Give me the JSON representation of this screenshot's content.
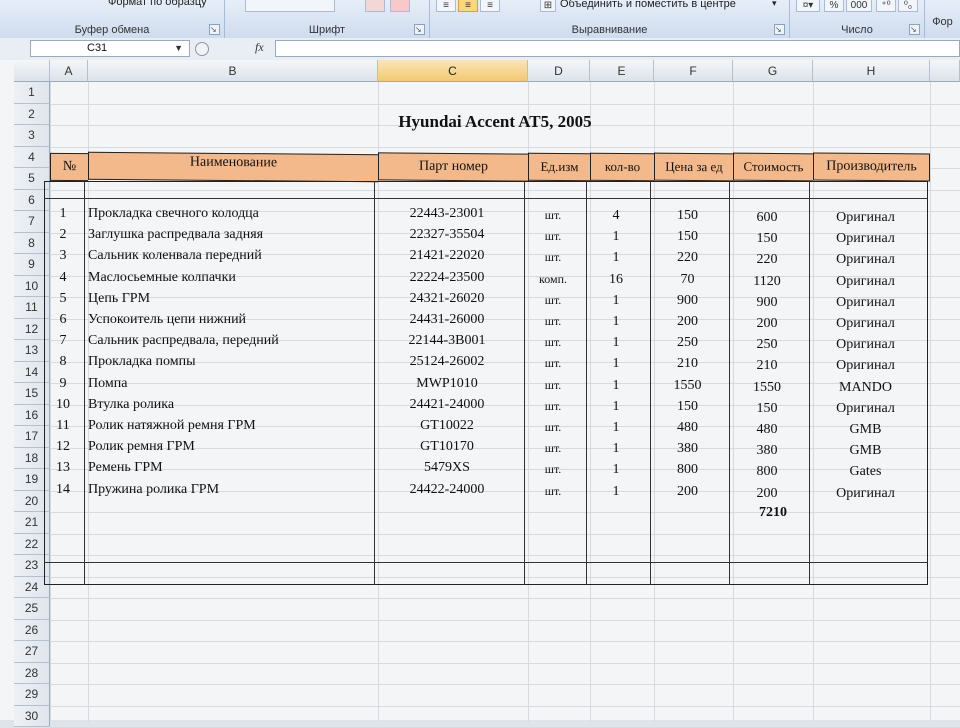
{
  "ribbon": {
    "clipboard_top": "Формат по образцу",
    "clipboard_label": "Буфер обмена",
    "font_label": "Шрифт",
    "merge_label": "Объединить и поместить в центре",
    "alignment_label": "Выравнивание",
    "number_label": "Число",
    "percent": "%",
    "thousands": "000",
    "styles_label": "Фор"
  },
  "formula_bar": {
    "name_box": "C31",
    "fx": "fx",
    "value": ""
  },
  "columns": [
    "A",
    "B",
    "C",
    "D",
    "E",
    "F",
    "G",
    "H"
  ],
  "selected_column": "C",
  "rows": [
    "1",
    "2",
    "3",
    "4",
    "5",
    "6",
    "7",
    "8",
    "9",
    "10",
    "11",
    "12",
    "13",
    "14",
    "15",
    "16",
    "17",
    "18",
    "19",
    "20",
    "21",
    "22",
    "23",
    "24",
    "25",
    "26",
    "27",
    "28",
    "29",
    "30"
  ],
  "sheet": {
    "title": "Hyundai Accent AT5, 2005",
    "headers": [
      "№",
      "Наименование",
      "Парт номер",
      "Ед.изм",
      "кол-во",
      "Цена за ед",
      "Стоимость",
      "Производитель"
    ],
    "items": [
      [
        "1",
        "Прокладка свечного колодца",
        "22443-23001",
        "шт.",
        "4",
        "150",
        "600",
        "Оригинал"
      ],
      [
        "2",
        "Заглушка распредвала задняя",
        "22327-35504",
        "шт.",
        "1",
        "150",
        "150",
        "Оригинал"
      ],
      [
        "3",
        "Сальник коленвала передний",
        "21421-22020",
        "шт.",
        "1",
        "220",
        "220",
        "Оригинал"
      ],
      [
        "4",
        "Маслосьемные колпачки",
        "22224-23500",
        "комп.",
        "16",
        "70",
        "1120",
        "Оригинал"
      ],
      [
        "5",
        "Цепь ГРМ",
        "24321-26020",
        "шт.",
        "1",
        "900",
        "900",
        "Оригинал"
      ],
      [
        "6",
        "Успокоитель цепи нижний",
        "24431-26000",
        "шт.",
        "1",
        "200",
        "200",
        "Оригинал"
      ],
      [
        "7",
        "Сальник распредвала, передний",
        "22144-3B001",
        "шт.",
        "1",
        "250",
        "250",
        "Оригинал"
      ],
      [
        "8",
        "Прокладка помпы",
        "25124-26002",
        "шт.",
        "1",
        "210",
        "210",
        "Оригинал"
      ],
      [
        "9",
        "Помпа",
        "MWP1010",
        "шт.",
        "1",
        "1550",
        "1550",
        "MANDO"
      ],
      [
        "10",
        "Втулка ролика",
        "24421-24000",
        "шт.",
        "1",
        "150",
        "150",
        "Оригинал"
      ],
      [
        "11",
        "Ролик натяжной ремня ГРМ",
        "GT10022",
        "шт.",
        "1",
        "480",
        "480",
        "GMB"
      ],
      [
        "12",
        "Ролик ремня ГРМ",
        "GT10170",
        "шт.",
        "1",
        "380",
        "380",
        "GMB"
      ],
      [
        "13",
        "Ремень ГРМ",
        "5479XS",
        "шт.",
        "1",
        "800",
        "800",
        "Gates"
      ],
      [
        "14",
        "Пружина ролика ГРМ",
        "24422-24000",
        "шт.",
        "1",
        "200",
        "200",
        "Оригинал"
      ]
    ],
    "total": "7210"
  }
}
